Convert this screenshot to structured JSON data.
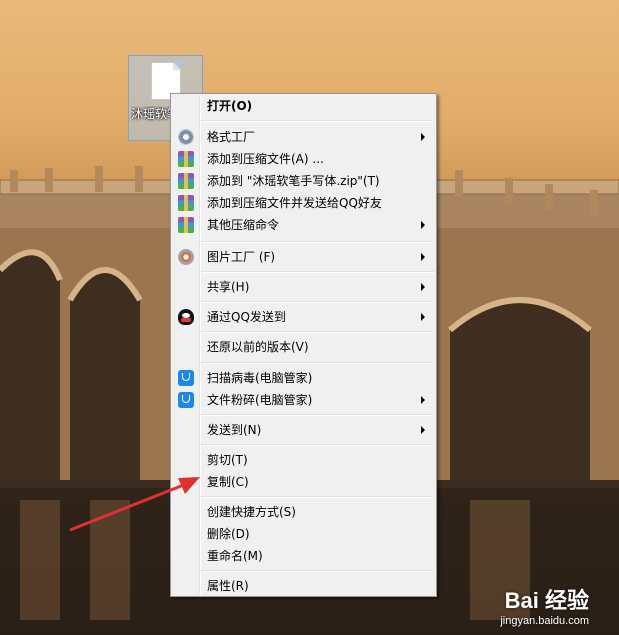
{
  "desktop": {
    "file": {
      "name": "沐瑶软笔手写体"
    }
  },
  "menu": {
    "items": [
      {
        "label": "打开(O)",
        "bold": true,
        "icon": "",
        "submenu": false
      },
      {
        "label": "格式工厂",
        "icon": "format-factory-icon",
        "submenu": true
      },
      {
        "label": "添加到压缩文件(A) ...",
        "icon": "winrar-icon",
        "submenu": false
      },
      {
        "label": "添加到 \"沐瑶软笔手写体.zip\"(T)",
        "icon": "winrar-icon",
        "submenu": false
      },
      {
        "label": "添加到压缩文件并发送给QQ好友",
        "icon": "winrar-icon",
        "submenu": false
      },
      {
        "label": "其他压缩命令",
        "icon": "winrar-icon",
        "submenu": true
      },
      {
        "label": "图片工厂 (F)",
        "icon": "picture-factory-icon",
        "submenu": true
      },
      {
        "label": "共享(H)",
        "icon": "",
        "submenu": true
      },
      {
        "label": "通过QQ发送到",
        "icon": "qq-icon",
        "submenu": true
      },
      {
        "label": "还原以前的版本(V)",
        "icon": "",
        "submenu": false
      },
      {
        "label": "扫描病毒(电脑管家)",
        "icon": "shield-icon",
        "submenu": false
      },
      {
        "label": "文件粉碎(电脑管家)",
        "icon": "shield-icon",
        "submenu": true
      },
      {
        "label": "发送到(N)",
        "icon": "",
        "submenu": true
      },
      {
        "label": "剪切(T)",
        "icon": "",
        "submenu": false
      },
      {
        "label": "复制(C)",
        "icon": "",
        "submenu": false
      },
      {
        "label": "创建快捷方式(S)",
        "icon": "",
        "submenu": false
      },
      {
        "label": "删除(D)",
        "icon": "",
        "submenu": false
      },
      {
        "label": "重命名(M)",
        "icon": "",
        "submenu": false
      },
      {
        "label": "属性(R)",
        "icon": "",
        "submenu": false
      }
    ]
  },
  "watermark": {
    "brand": "Bai 经验",
    "url": "jingyan.baidu.com"
  },
  "colors": {
    "annotation_arrow": "#e03030",
    "menu_bg": "#f0f0f0"
  }
}
